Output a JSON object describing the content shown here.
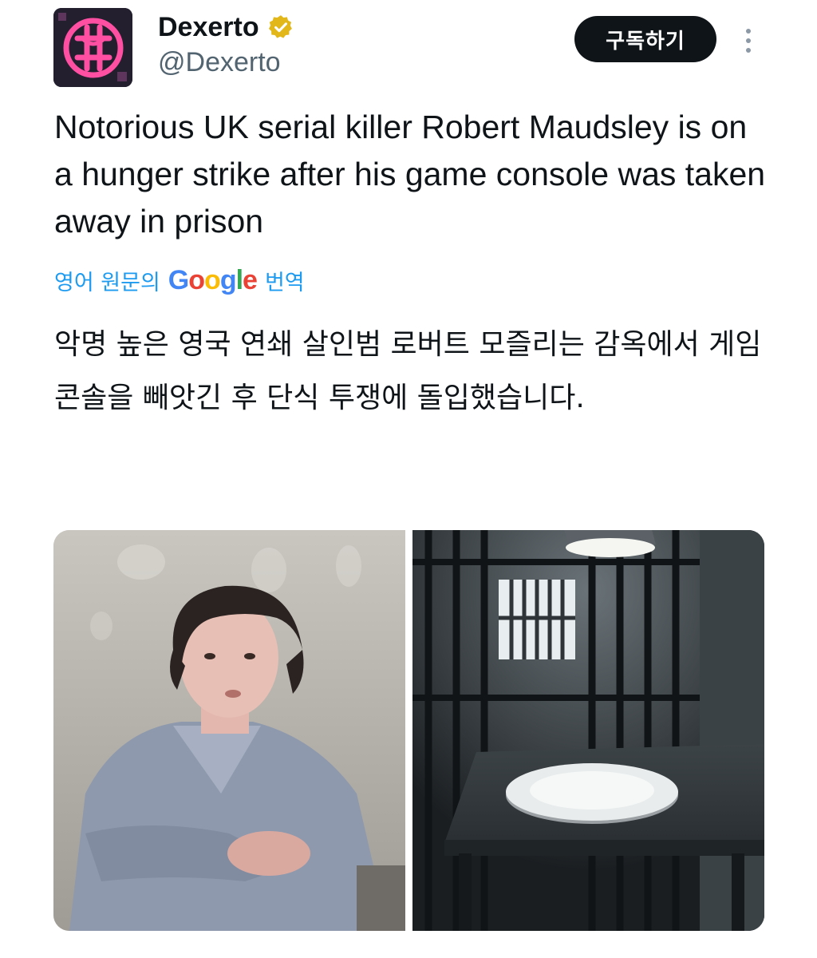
{
  "author": {
    "name": "Dexerto",
    "handle": "@Dexerto",
    "verified_badge_color": "#e2b719",
    "avatar_icon": "dexerto-logo-icon",
    "avatar_color": "#e6408f"
  },
  "actions": {
    "subscribe_label": "구독하기",
    "more_icon": "more-vertical-icon"
  },
  "tweet": {
    "text": "Notorious UK serial killer Robert Maudsley is on a hunger strike after his game console was taken away in prison"
  },
  "translation": {
    "prefix": "영어 원문의",
    "provider": "Google",
    "suffix": "번역",
    "text": "악명 높은 영국 연쇄 살인범 로버트 모즐리는 감옥에서 게임 콘솔을 빼앗긴 후 단식 투쟁에 돌입했습니다."
  },
  "media": {
    "left_image": "man-portrait-photo",
    "right_image": "prison-cell-empty-plate-photo"
  },
  "colors": {
    "text_primary": "#0f1419",
    "text_secondary": "#536471",
    "link": "#1d9bf0",
    "button_bg": "#0f1419"
  }
}
